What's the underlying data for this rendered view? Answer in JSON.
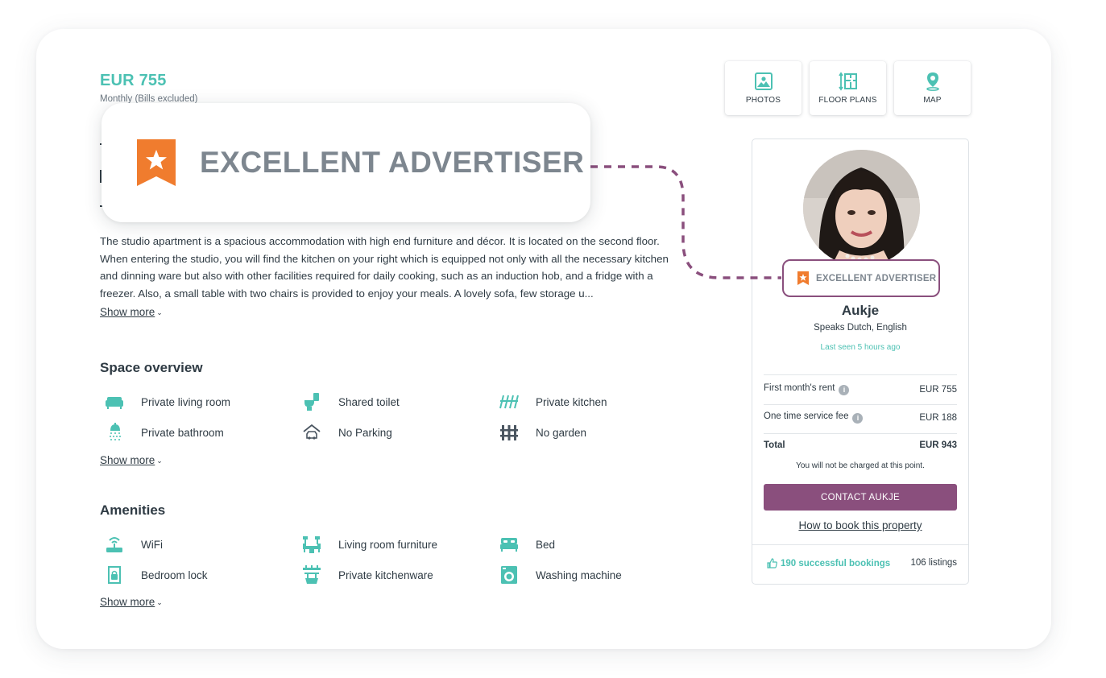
{
  "listing": {
    "price": "EUR 755",
    "price_note": "Monthly (Bills excluded)",
    "description": "The studio apartment is a spacious accommodation with high end furniture and décor. It is located on the second floor. When entering the studio, you will find the kitchen on your right which is equipped not only with all the necessary kitchen and dinning ware but also with other facilities required for daily cooking, such as an induction hob, and a fridge with a freezer. Also, a small table with two chairs is provided to enjoy your meals. A lovely sofa, few storage u...",
    "show_more": "Show more"
  },
  "callout": {
    "label": "EXCELLENT ADVERTISER",
    "badge_color": "#f07c2e"
  },
  "space_overview": {
    "title": "Space overview",
    "items": [
      {
        "label": "Private living room",
        "icon": "sofa-icon"
      },
      {
        "label": "Shared toilet",
        "icon": "toilet-icon"
      },
      {
        "label": "Private kitchen",
        "icon": "kitchen-icon"
      },
      {
        "label": "Private bathroom",
        "icon": "shower-icon"
      },
      {
        "label": "No Parking",
        "icon": "car-garage-icon"
      },
      {
        "label": "No garden",
        "icon": "fence-icon"
      }
    ],
    "show_more": "Show more"
  },
  "amenities": {
    "title": "Amenities",
    "items": [
      {
        "label": "WiFi",
        "icon": "wifi-router-icon"
      },
      {
        "label": "Living room furniture",
        "icon": "furniture-icon"
      },
      {
        "label": "Bed",
        "icon": "bed-icon"
      },
      {
        "label": "Bedroom lock",
        "icon": "lock-door-icon"
      },
      {
        "label": "Private kitchenware",
        "icon": "kitchenware-icon"
      },
      {
        "label": "Washing machine",
        "icon": "washing-machine-icon"
      }
    ],
    "show_more": "Show more"
  },
  "media_tabs": [
    {
      "label": "PHOTOS",
      "icon": "photo-icon"
    },
    {
      "label": "FLOOR PLANS",
      "icon": "floor-plan-icon"
    },
    {
      "label": "MAP",
      "icon": "map-pin-icon"
    }
  ],
  "host": {
    "badge_label": "EXCELLENT ADVERTISER",
    "name": "Aukje",
    "languages": "Speaks Dutch, English",
    "last_seen": "Last seen 5 hours ago"
  },
  "pricing": {
    "rows": [
      {
        "label": "First month's rent",
        "value": "EUR 755",
        "info": true
      },
      {
        "label": "One time service fee",
        "value": "EUR 188",
        "info": true
      },
      {
        "label": "Total",
        "value": "EUR 943",
        "info": false
      }
    ],
    "note": "You will not be charged at this point.",
    "contact_button": "CONTACT AUKJE",
    "how_to_book": "How to book this property"
  },
  "stats": {
    "bookings": "190 successful bookings",
    "listings": "106 listings"
  },
  "colors": {
    "teal": "#4cc1b3",
    "purple": "#8a4f7d",
    "orange": "#f07c2e",
    "text": "#2f3b44"
  }
}
